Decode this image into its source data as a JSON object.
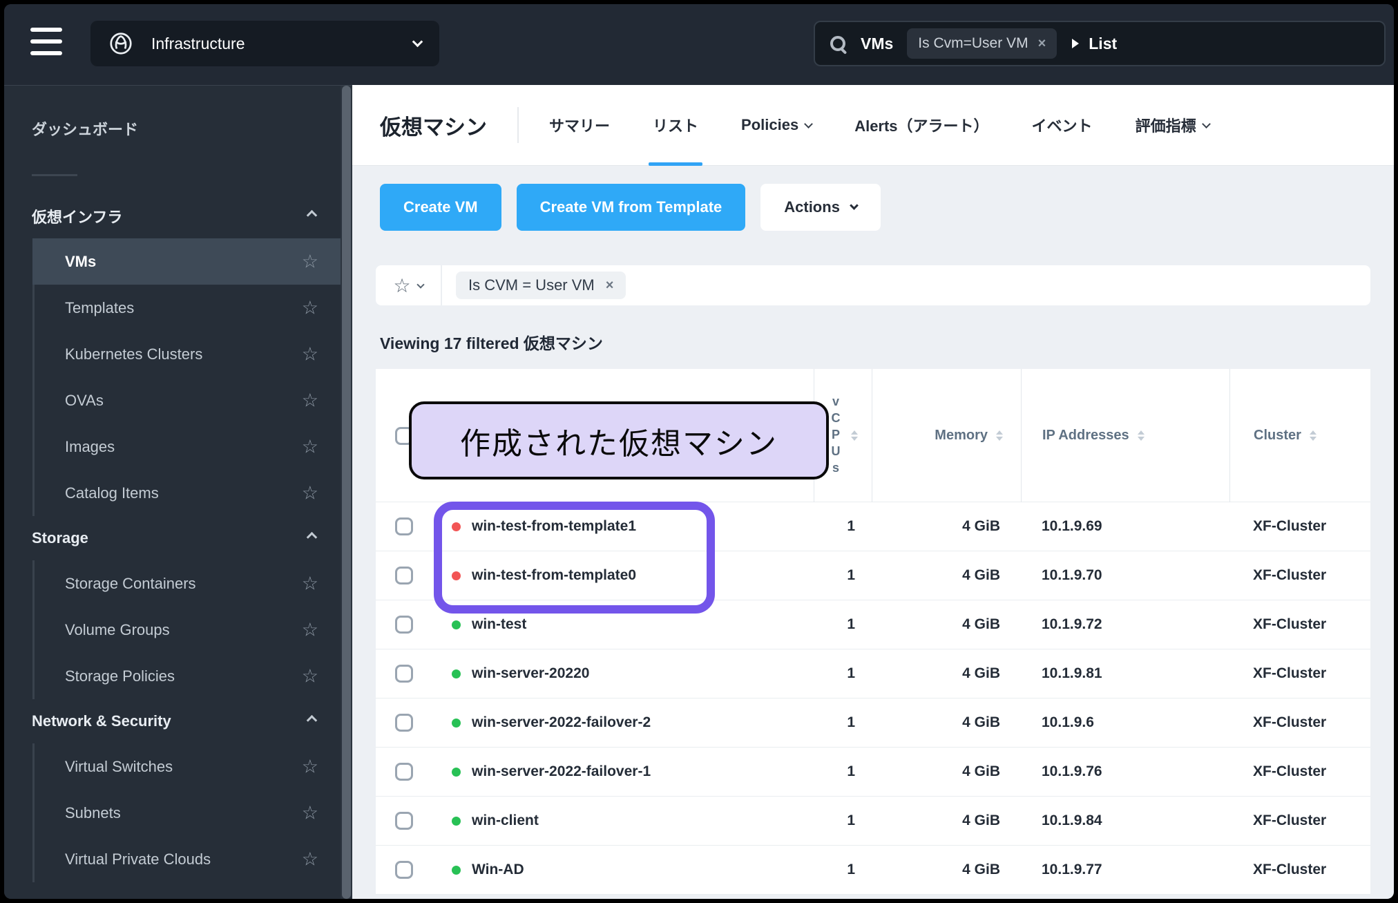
{
  "topbar": {
    "app_switcher_label": "Infrastructure",
    "search": {
      "entity_label": "VMs",
      "chip_label": "Is Cvm=User VM",
      "chip_close": "×",
      "breadcrumb_label": "List"
    }
  },
  "sidebar": {
    "dashboard_label": "ダッシュボード",
    "sections": [
      {
        "label": "仮想インフラ",
        "items": [
          "VMs",
          "Templates",
          "Kubernetes Clusters",
          "OVAs",
          "Images",
          "Catalog Items"
        ]
      },
      {
        "label": "Storage",
        "items": [
          "Storage Containers",
          "Volume Groups",
          "Storage Policies"
        ]
      },
      {
        "label": "Network & Security",
        "items": [
          "Virtual Switches",
          "Subnets",
          "Virtual Private Clouds"
        ]
      }
    ],
    "selected_item": "VMs"
  },
  "main": {
    "page_title": "仮想マシン",
    "tabs": [
      {
        "label": "サマリー"
      },
      {
        "label": "リスト",
        "active": true
      },
      {
        "label": "Policies",
        "dropdown": true
      },
      {
        "label": "Alerts（アラート）"
      },
      {
        "label": "イベント"
      },
      {
        "label": "評価指標",
        "dropdown": true
      }
    ],
    "buttons": {
      "create_vm": "Create VM",
      "create_vm_from_template": "Create VM from Template",
      "actions_menu": "Actions"
    },
    "filter_bar": {
      "chip_label": "Is CVM = User VM",
      "chip_close": "×"
    },
    "viewing_text": "Viewing 17 filtered 仮想マシン",
    "annotation_label": "作成された仮想マシン",
    "table": {
      "headers": {
        "vcpus": "vCPUs",
        "memory": "Memory",
        "ip": "IP Addresses",
        "cluster": "Cluster"
      },
      "rows": [
        {
          "name": "win-test-from-template1",
          "status": "red",
          "vcpus": "1",
          "memory": "4 GiB",
          "ip": "10.1.9.69",
          "cluster": "XF-Cluster"
        },
        {
          "name": "win-test-from-template0",
          "status": "red",
          "vcpus": "1",
          "memory": "4 GiB",
          "ip": "10.1.9.70",
          "cluster": "XF-Cluster"
        },
        {
          "name": "win-test",
          "status": "green",
          "vcpus": "1",
          "memory": "4 GiB",
          "ip": "10.1.9.72",
          "cluster": "XF-Cluster"
        },
        {
          "name": "win-server-20220",
          "status": "green",
          "vcpus": "1",
          "memory": "4 GiB",
          "ip": "10.1.9.81",
          "cluster": "XF-Cluster"
        },
        {
          "name": "win-server-2022-failover-2",
          "status": "green",
          "vcpus": "1",
          "memory": "4 GiB",
          "ip": "10.1.9.6",
          "cluster": "XF-Cluster"
        },
        {
          "name": "win-server-2022-failover-1",
          "status": "green",
          "vcpus": "1",
          "memory": "4 GiB",
          "ip": "10.1.9.76",
          "cluster": "XF-Cluster"
        },
        {
          "name": "win-client",
          "status": "green",
          "vcpus": "1",
          "memory": "4 GiB",
          "ip": "10.1.9.84",
          "cluster": "XF-Cluster"
        },
        {
          "name": "Win-AD",
          "status": "green",
          "vcpus": "1",
          "memory": "4 GiB",
          "ip": "10.1.9.77",
          "cluster": "XF-Cluster"
        }
      ]
    }
  },
  "colors": {
    "accent_blue": "#2fa9f7",
    "tab_underline": "#30a3f5",
    "status_red": "#f25555",
    "status_green": "#28c155",
    "annotation_purple": "#7355ea",
    "annotation_label_bg": "#ddd6f8"
  }
}
